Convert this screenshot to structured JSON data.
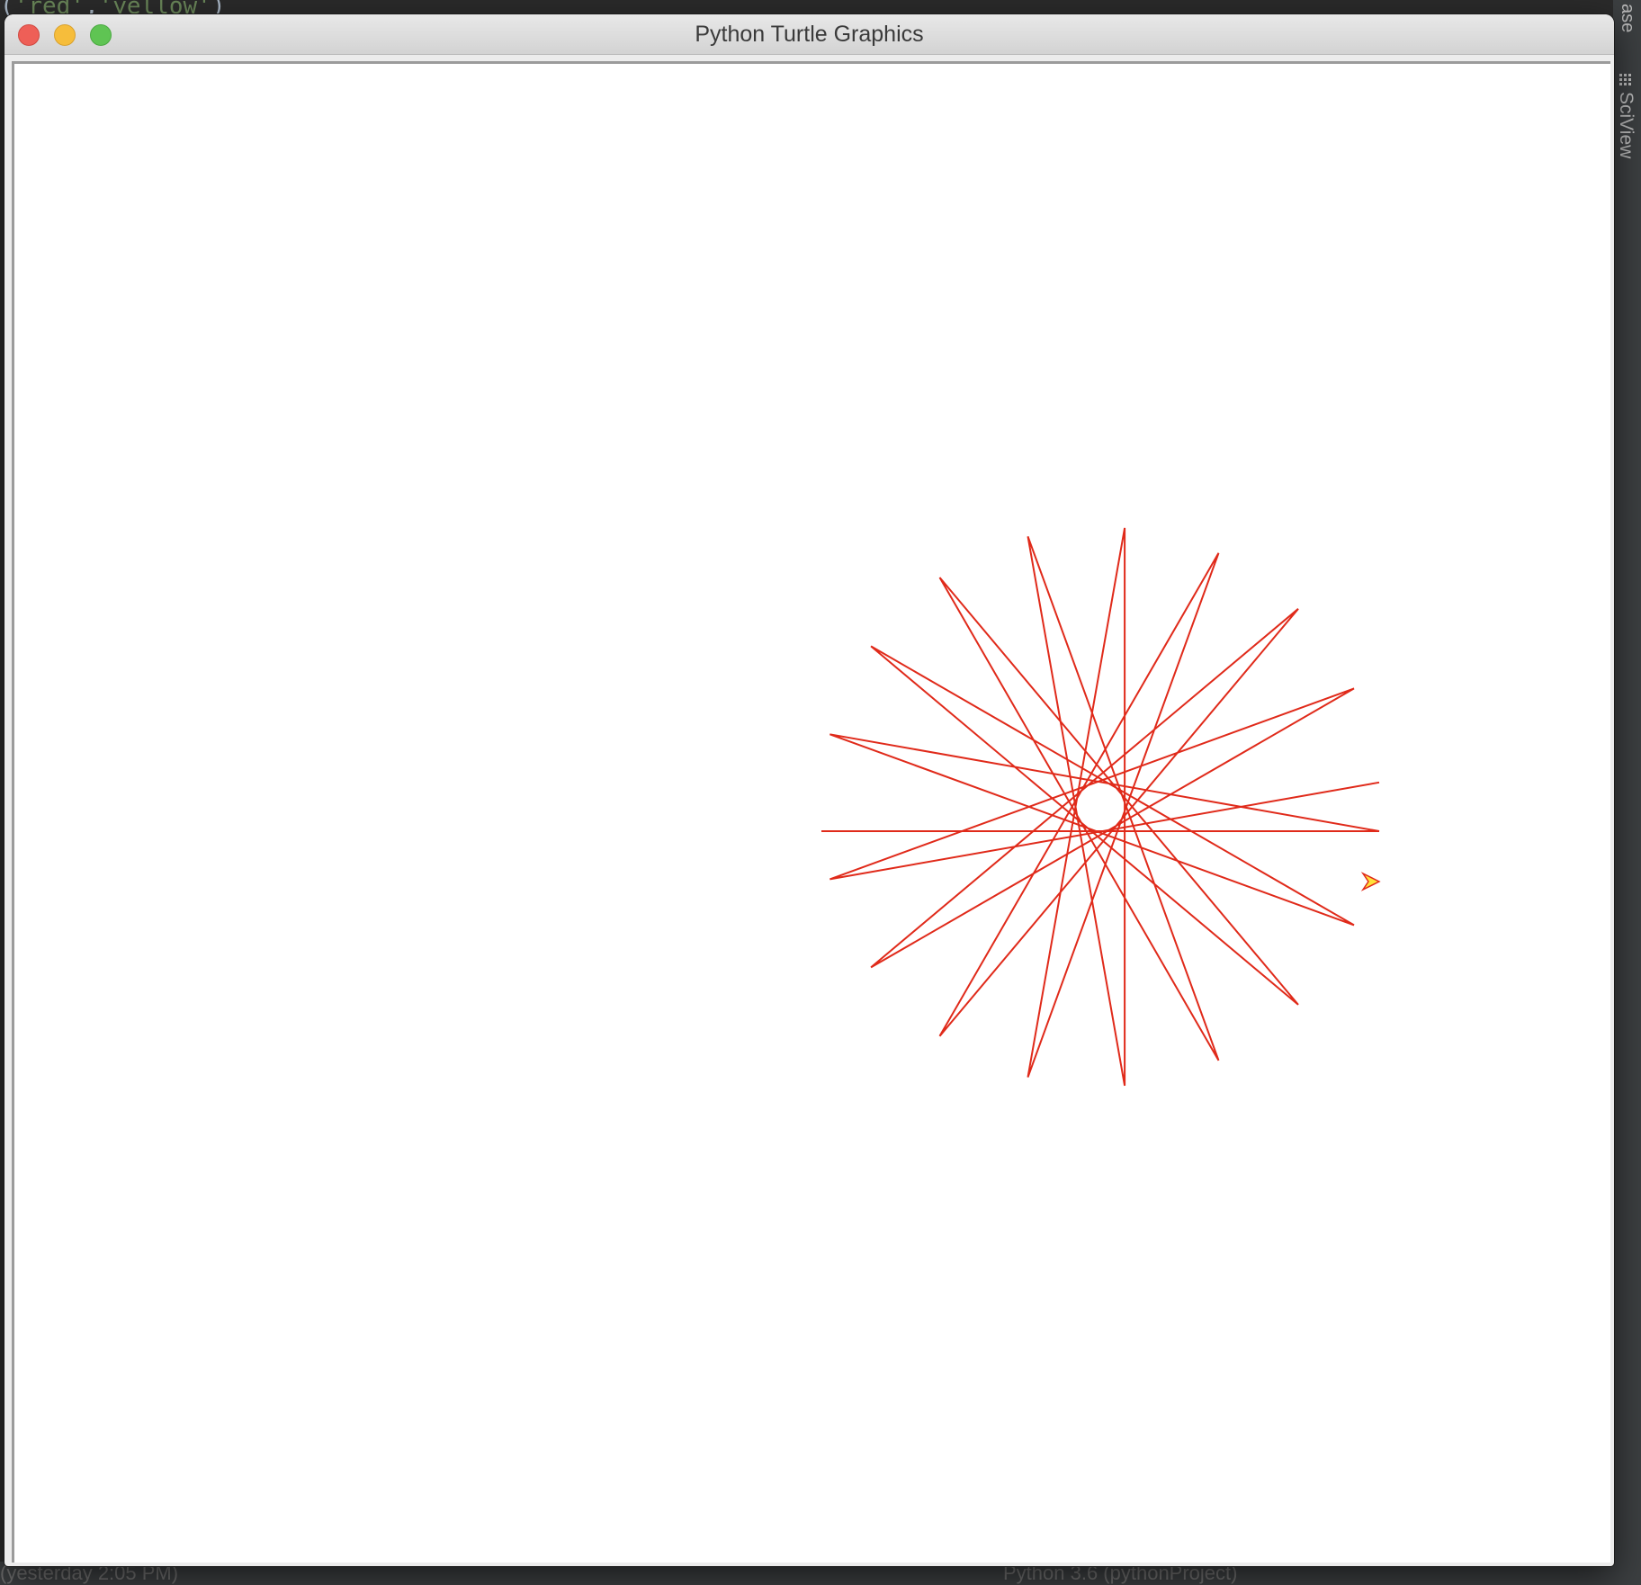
{
  "window": {
    "title": "Python Turtle Graphics",
    "buttons": [
      "close",
      "minimize",
      "maximize"
    ]
  },
  "background_ide": {
    "code_fragment_1": "red",
    "code_fragment_2": "yellow",
    "right_panel_fragment": "ase",
    "right_panel_tab": "SciView",
    "status_left": "(yesterday 2:05 PM)",
    "status_right": "Python 3.6 (pythonProject)"
  },
  "turtle": {
    "pen_color": "#e02a1a",
    "turtle_fill_color": "#ffe23a",
    "turtle_outline_color": "#e02a1a",
    "shape": "classic-arrow",
    "star_points": 18,
    "turn_angle_deg": 170
  }
}
